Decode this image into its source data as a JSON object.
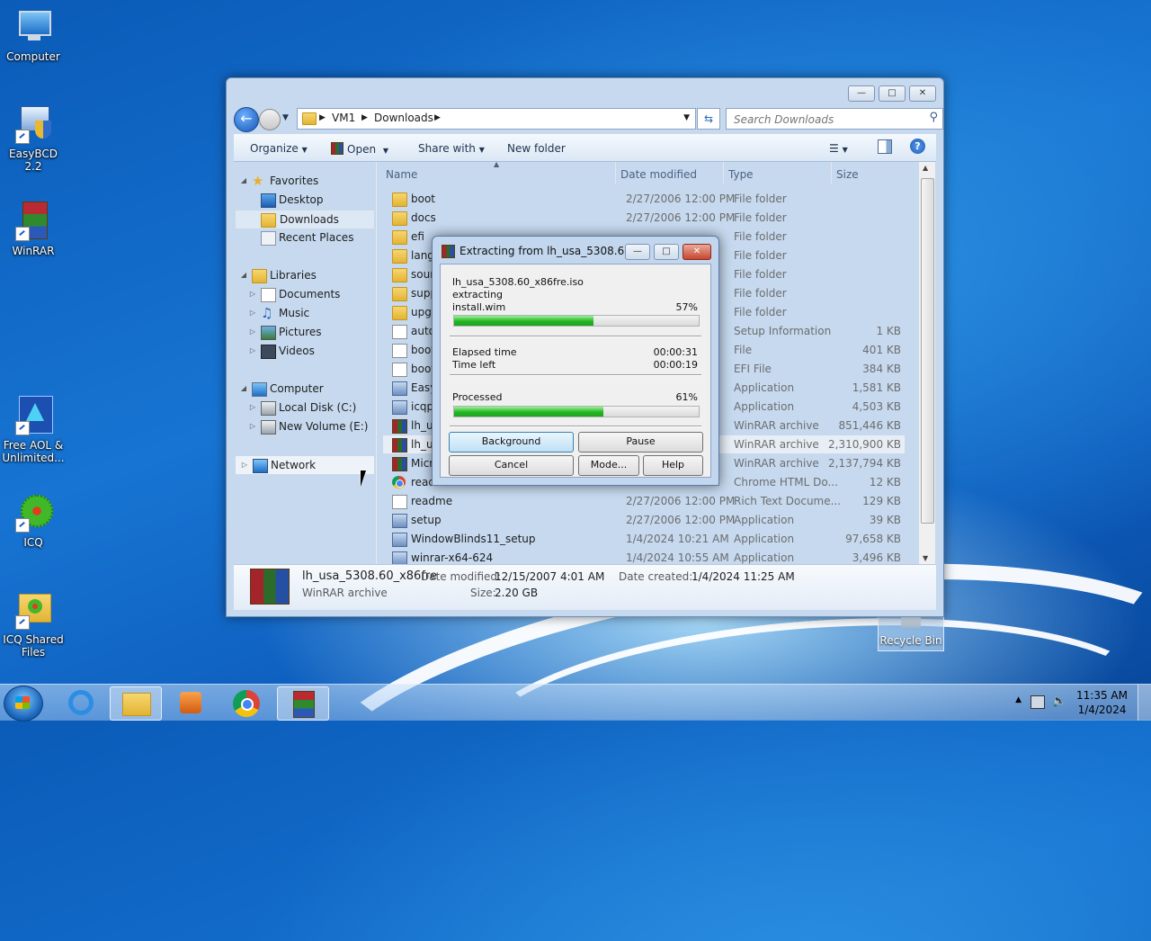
{
  "desktop": {
    "icons": [
      {
        "label": "Computer"
      },
      {
        "label": "EasyBCD 2.2"
      },
      {
        "label": "WinRAR"
      },
      {
        "label": "Free AOL & Unlimited..."
      },
      {
        "label": "ICQ"
      },
      {
        "label": "ICQ Shared Files"
      }
    ],
    "recycle_bin": "Recycle Bin"
  },
  "explorer": {
    "breadcrumb": [
      "VM1",
      "Downloads"
    ],
    "search_placeholder": "Search Downloads",
    "toolbar": {
      "organize": "Organize",
      "open": "Open",
      "share_with": "Share with",
      "new_folder": "New folder"
    },
    "nav": {
      "favorites": "Favorites",
      "desktop": "Desktop",
      "downloads": "Downloads",
      "recent_places": "Recent Places",
      "libraries": "Libraries",
      "documents": "Documents",
      "music": "Music",
      "pictures": "Pictures",
      "videos": "Videos",
      "computer": "Computer",
      "local_disk": "Local Disk (C:)",
      "new_volume": "New Volume (E:)",
      "network": "Network"
    },
    "columns": {
      "name": "Name",
      "date": "Date modified",
      "type": "Type",
      "size": "Size"
    },
    "files": [
      {
        "name": "boot",
        "date": "2/27/2006 12:00 PM",
        "type": "File folder",
        "size": "",
        "icon": "folder"
      },
      {
        "name": "docs",
        "date": "2/27/2006 12:00 PM",
        "type": "File folder",
        "size": "",
        "icon": "folder"
      },
      {
        "name": "efi",
        "date": "",
        "type": "File folder",
        "size": "",
        "icon": "folder"
      },
      {
        "name": "lang",
        "date": "",
        "type": "File folder",
        "size": "",
        "icon": "folder"
      },
      {
        "name": "sour",
        "date": "",
        "type": "File folder",
        "size": "",
        "icon": "folder"
      },
      {
        "name": "supp",
        "date": "",
        "type": "File folder",
        "size": "",
        "icon": "folder"
      },
      {
        "name": "upgr",
        "date": "",
        "type": "File folder",
        "size": "",
        "icon": "folder"
      },
      {
        "name": "auto",
        "date": "",
        "type": "Setup Information",
        "size": "1 KB",
        "icon": "doc"
      },
      {
        "name": "boot",
        "date": "",
        "type": "File",
        "size": "401 KB",
        "icon": "doc"
      },
      {
        "name": "boot",
        "date": "",
        "type": "EFI File",
        "size": "384 KB",
        "icon": "doc"
      },
      {
        "name": "Easy",
        "date": "",
        "type": "Application",
        "size": "1,581 KB",
        "icon": "app"
      },
      {
        "name": "icqp",
        "date": "",
        "type": "Application",
        "size": "4,503 KB",
        "icon": "app"
      },
      {
        "name": "lh_us",
        "date": "",
        "type": "WinRAR archive",
        "size": "851,446 KB",
        "icon": "rar"
      },
      {
        "name": "lh_us",
        "date": "",
        "type": "WinRAR archive",
        "size": "2,310,900 KB",
        "icon": "rar",
        "highlight": true
      },
      {
        "name": "Micr",
        "date": "",
        "type": "WinRAR archive",
        "size": "2,137,794 KB",
        "icon": "rar"
      },
      {
        "name": "readme",
        "date": "",
        "type": "Chrome HTML Do...",
        "size": "12 KB",
        "icon": "chrome"
      },
      {
        "name": "readme",
        "date": "2/27/2006 12:00 PM",
        "type": "Rich Text Docume...",
        "size": "129 KB",
        "icon": "doc"
      },
      {
        "name": "setup",
        "date": "2/27/2006 12:00 PM",
        "type": "Application",
        "size": "39 KB",
        "icon": "app"
      },
      {
        "name": "WindowBlinds11_setup",
        "date": "1/4/2024 10:21 AM",
        "type": "Application",
        "size": "97,658 KB",
        "icon": "app"
      },
      {
        "name": "winrar-x64-624",
        "date": "1/4/2024 10:55 AM",
        "type": "Application",
        "size": "3,496 KB",
        "icon": "app"
      }
    ],
    "details": {
      "name": "lh_usa_5308.60_x86fre",
      "type": "WinRAR archive",
      "modified_label": "Date modified:",
      "modified": "12/15/2007 4:01 AM",
      "created_label": "Date created:",
      "created": "1/4/2024 11:25 AM",
      "size_label": "Size:",
      "size": "2.20 GB"
    }
  },
  "dialog": {
    "title": "Extracting from lh_usa_5308.60_...",
    "archive": "lh_usa_5308.60_x86fre.iso",
    "action": "extracting",
    "file": "install.wim",
    "file_percent": "57%",
    "file_progress": 0.57,
    "elapsed_label": "Elapsed time",
    "elapsed": "00:00:31",
    "left_label": "Time left",
    "left": "00:00:19",
    "processed_label": "Processed",
    "processed_percent": "61%",
    "processed_progress": 0.61,
    "buttons": {
      "background": "Background",
      "pause": "Pause",
      "cancel": "Cancel",
      "mode": "Mode...",
      "help": "Help"
    }
  },
  "taskbar": {
    "time": "11:35 AM",
    "date": "1/4/2024"
  }
}
